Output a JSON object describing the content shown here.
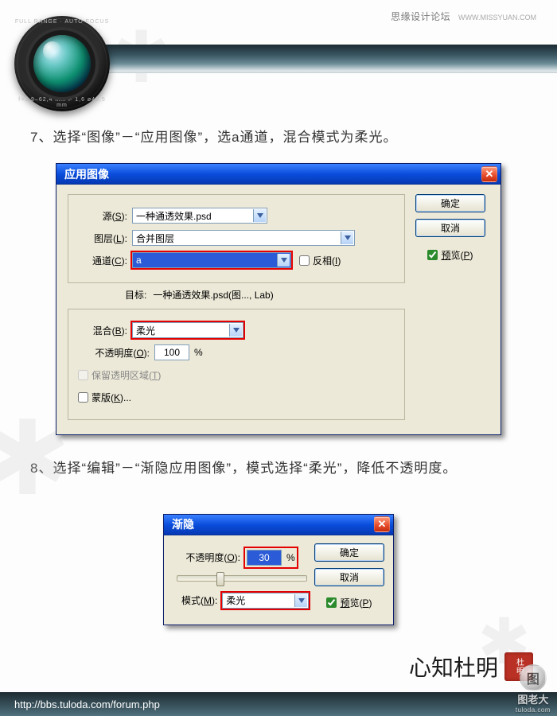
{
  "header": {
    "site_name": "思缘设计论坛",
    "site_url": "WWW.MISSYUAN.COM",
    "lens_ring_top": "FULL RANGE · AUTO FOCUS",
    "lens_ring_bottom": "f=3,9–62,4 mm   F 1,6 ø40,5 mm"
  },
  "steps": {
    "s7": "7、选择“图像”－“应用图像”，选a通道，混合模式为柔光。",
    "s8": "8、选择“编辑”－“渐隐应用图像”，模式选择“柔光”，降低不透明度。"
  },
  "dialog1": {
    "title": "应用图像",
    "source_label": "源(S):",
    "source_value": "一种通透效果.psd",
    "layer_label": "图层(L):",
    "layer_value": "合并图层",
    "channel_label": "通道(C):",
    "channel_value": "a",
    "invert_label": "反相(I)",
    "target_label": "目标:",
    "target_value": "一种通透效果.psd(图..., Lab)",
    "blend_label": "混合(B):",
    "blend_value": "柔光",
    "opacity_label": "不透明度(O):",
    "opacity_value": "100",
    "percent": "%",
    "preserve_trans_label": "保留透明区域(T)",
    "mask_label": "蒙版(K)...",
    "ok": "确定",
    "cancel": "取消",
    "preview": "预览(P)",
    "invert_checked": false,
    "preview_checked": true,
    "preserve_trans_checked": false,
    "mask_checked": false
  },
  "dialog2": {
    "title": "渐隐",
    "opacity_label": "不透明度(O):",
    "opacity_value": "30",
    "percent": "%",
    "mode_label": "模式(M):",
    "mode_value": "柔光",
    "ok": "确定",
    "cancel": "取消",
    "preview": "预览(P)",
    "preview_checked": true,
    "slider_percent": 30
  },
  "footer": {
    "url": "http://bbs.tuloda.com/forum.php",
    "watermark_title": "图老大",
    "watermark_sub": "tuloda.com",
    "signature": "心知杜明",
    "seal": "杜明"
  }
}
